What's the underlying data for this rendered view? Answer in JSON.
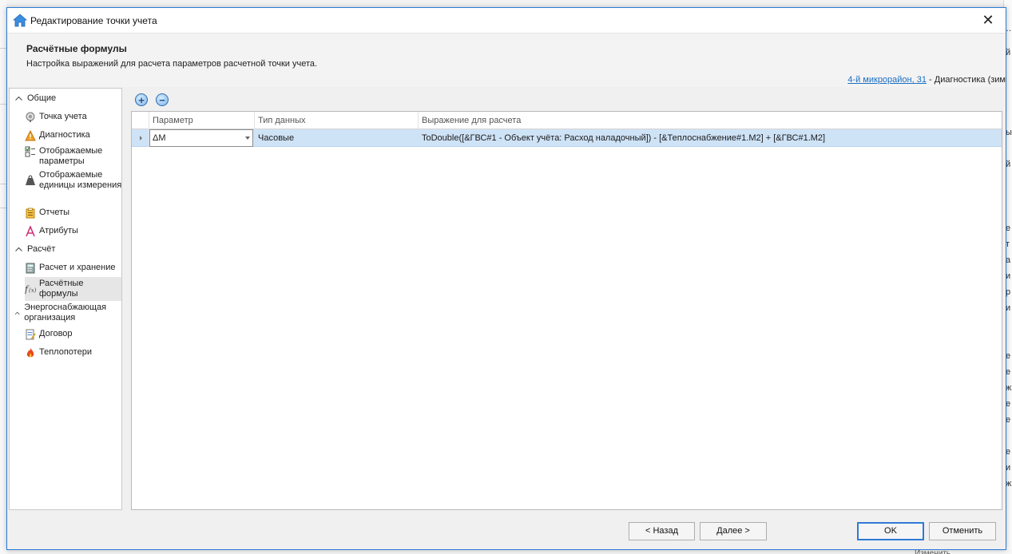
{
  "window": {
    "title": "Редактирование точки учета",
    "close_glyph": "✕"
  },
  "header": {
    "title": "Расчётные формулы",
    "subtitle": "Настройка выражений для расчета параметров расчетной точки учета.",
    "breadcrumb_link": "4-й микрорайон, 31",
    "breadcrumb_rest": " - Диагностика (зим"
  },
  "nav": {
    "groups": [
      {
        "label": "Общие",
        "icon": "chevron-up-icon"
      },
      {
        "label": "Расчёт",
        "icon": "chevron-up-icon"
      },
      {
        "label": "Энергоснабжающая организация",
        "icon": "chevron-up-icon"
      }
    ],
    "items": [
      {
        "label": "Точка учета",
        "icon": "meter-icon"
      },
      {
        "label": "Диагностика",
        "icon": "warning-icon"
      },
      {
        "label": "Отображаемые параметры",
        "icon": "checklist-icon"
      },
      {
        "label": "Отображаемые единицы измерения",
        "icon": "weight-icon"
      },
      {
        "label": "Отчеты",
        "icon": "clipboard-icon"
      },
      {
        "label": "Атрибуты",
        "icon": "letter-a-icon"
      },
      {
        "label": "Расчет и хранение",
        "icon": "calculator-icon"
      },
      {
        "label": "Расчётные формулы",
        "icon": "function-icon"
      },
      {
        "label": "Договор",
        "icon": "contract-icon"
      },
      {
        "label": "Теплопотери",
        "icon": "fire-icon"
      }
    ],
    "selected": "Расчётные формулы"
  },
  "toolbar": {
    "add": "+",
    "remove": "−"
  },
  "grid": {
    "columns": [
      "Параметр",
      "Тип данных",
      "Выражение для расчета"
    ],
    "rows": [
      {
        "param": "ΔM",
        "type": "Часовые",
        "expression": "ToDouble([&ГВС#1 - Объект учёта: Расход наладочный]) - [&Теплоснабжение#1.M2] + [&ГВС#1.M2]"
      }
    ]
  },
  "footer": {
    "back": "< Назад",
    "next": "Далее >",
    "ok": "OK",
    "cancel": "Отменить"
  },
  "background": {
    "right_fragments": [
      "…",
      "й",
      "ы",
      "й",
      "й",
      "е",
      "т",
      "а",
      "и",
      "р",
      "и",
      "е",
      "е",
      "ж",
      "е",
      "е",
      "е",
      "и",
      "ж"
    ],
    "bottom_text": "Изменить"
  },
  "colors": {
    "accent": "#2b7bd6",
    "selection": "#cfe3f7",
    "link": "#1b6ec2"
  }
}
